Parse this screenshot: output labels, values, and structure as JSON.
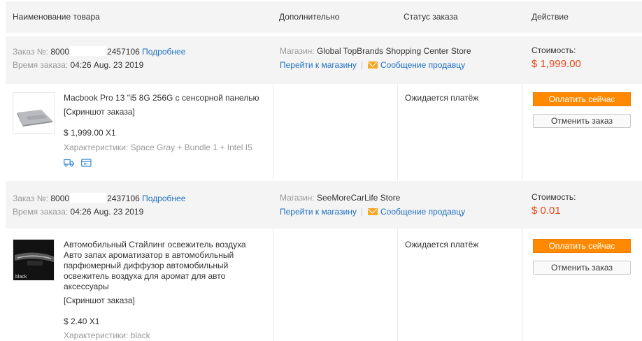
{
  "header": {
    "col_product": "Наименование товара",
    "col_extra": "Дополнительно",
    "col_status": "Статус заказа",
    "col_action": "Действие"
  },
  "orders": [
    {
      "order_label": "Заказ №:",
      "order_no_start": "8000",
      "order_no_end": "2457106",
      "details_link": "Подробнее",
      "time_label": "Время заказа:",
      "time_value": "04:26 Aug. 23 2019",
      "store_label": "Магазин:",
      "store_name": "Global TopBrands Shopping Center Store",
      "store_link": "Перейти к магазину",
      "message_link": "Сообщение продавцу",
      "cost_label": "Стоимость:",
      "cost_value": "$ 1,999.00",
      "product_name": "Macbook Pro 13 \"i5 8G 256G с сенсорной панелью",
      "screenshot_label": "[Скриншот заказа]",
      "qty": "$ 1,999.00 X1",
      "attrs": "Характеристики: Space Gray + Bundle 1 + Intel I5",
      "status": "Ожидается платёж",
      "pay_button": "Оплатить сейчас",
      "cancel_button": "Отменить заказ"
    },
    {
      "order_label": "Заказ №:",
      "order_no_start": "8000",
      "order_no_end": "2437106",
      "details_link": "Подробнее",
      "time_label": "Время заказа:",
      "time_value": "04:26 Aug. 23 2019",
      "store_label": "Магазин:",
      "store_name": "SeeMoreCarLife Store",
      "store_link": "Перейти к магазину",
      "message_link": "Сообщение продавцу",
      "cost_label": "Стоимость:",
      "cost_value": "$ 0.01",
      "product_name": "Автомобильный Стайлинг освежитель воздуха Авто запах ароматизатор в автомобильный парфюмерный диффузор автомобильный освежитель воздуха для аромат для авто аксессуары",
      "screenshot_label": "[Скриншот заказа]",
      "qty": "$ 2.40 X1",
      "attrs": "Характеристики: black",
      "status": "Ожидается платёж",
      "pay_button": "Оплатить сейчас",
      "cancel_button": "Отменить заказ",
      "thumb_text": "black"
    }
  ],
  "colors": {
    "link": "#1e6fc1",
    "price": "#e84a1a",
    "pay_button": "#ff8a00",
    "header_bg": "#f4f4f4"
  }
}
